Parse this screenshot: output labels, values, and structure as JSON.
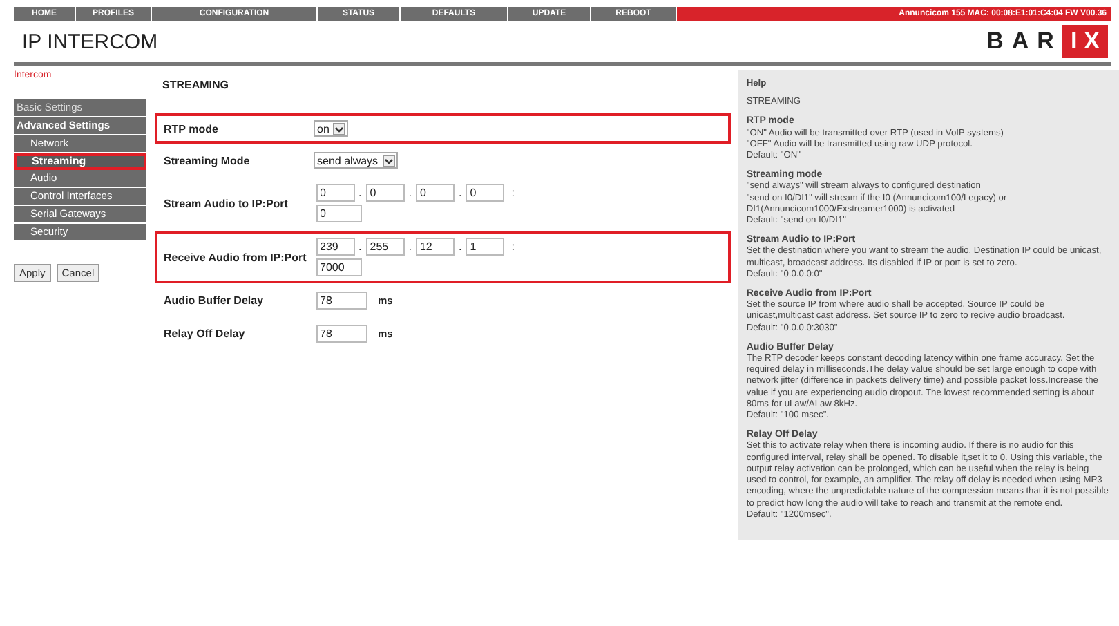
{
  "nav": {
    "items": [
      "HOME",
      "PROFILES",
      "CONFIGURATION",
      "STATUS",
      "DEFAULTS",
      "UPDATE",
      "REBOOT"
    ],
    "device_info": "Annuncicom 155   MAC: 00:08:E1:01:C4:04   FW V00.36"
  },
  "header": {
    "title": "IP INTERCOM",
    "logo_left": "BAR",
    "logo_right": "IX"
  },
  "breadcrumb": "Intercom",
  "sidebar": {
    "items": [
      {
        "label": "Basic Settings",
        "kind": "section",
        "selected": false
      },
      {
        "label": "Advanced Settings",
        "kind": "section-open",
        "selected": false
      },
      {
        "label": "Network",
        "kind": "sub",
        "selected": false
      },
      {
        "label": "Streaming",
        "kind": "sub",
        "selected": true
      },
      {
        "label": "Audio",
        "kind": "sub",
        "selected": false
      },
      {
        "label": "Control Interfaces",
        "kind": "sub",
        "selected": false
      },
      {
        "label": "Serial Gateways",
        "kind": "sub",
        "selected": false
      },
      {
        "label": "Security",
        "kind": "sub",
        "selected": false
      }
    ]
  },
  "buttons": [
    "Apply",
    "Cancel"
  ],
  "form": {
    "title": "STREAMING",
    "rows": [
      {
        "kind": "select",
        "label": "RTP mode",
        "value": "on",
        "highlighted": true
      },
      {
        "kind": "select",
        "label": "Streaming Mode",
        "value": "send always",
        "highlighted": false
      },
      {
        "kind": "ip",
        "label": "Stream Audio to IP:Port",
        "octets": [
          "0",
          "0",
          "0",
          "0"
        ],
        "octet_separator": ".",
        "port_separator": ":",
        "port": "0",
        "highlighted": false
      },
      {
        "kind": "ip",
        "label": "Receive Audio from IP:Port",
        "octets": [
          "239",
          "255",
          "12",
          "1"
        ],
        "octet_separator": ".",
        "port_separator": ":",
        "port": "7000",
        "highlighted": true
      },
      {
        "kind": "unit",
        "label": "Audio Buffer Delay",
        "value": "78",
        "unit": "ms",
        "highlighted": false
      },
      {
        "kind": "unit",
        "label": "Relay Off Delay",
        "value": "78",
        "unit": "ms",
        "highlighted": false
      }
    ]
  },
  "help": {
    "title": "Help",
    "subtitle": "STREAMING",
    "sections": [
      {
        "heading": "RTP mode",
        "lines": [
          "\"ON\" Audio will be transmitted over RTP (used in VoIP systems)",
          "\"OFF\" Audio will be transmitted using raw UDP protocol.",
          "Default: \"ON\""
        ]
      },
      {
        "heading": "Streaming mode",
        "lines": [
          "\"send always\" will stream always to configured destination",
          "\"send on I0/DI1\" will stream if the I0 (Annuncicom100/Legacy) or DI1(Annuncicom1000/Exstreamer1000) is activated",
          "Default: \"send on I0/DI1\""
        ]
      },
      {
        "heading": "Stream Audio to IP:Port",
        "lines": [
          "Set the destination where you want to stream the audio. Destination IP could be unicast, multicast, broadcast address. Its disabled if IP or port is set to zero.",
          "Default: \"0.0.0.0:0\""
        ]
      },
      {
        "heading": "Receive Audio from IP:Port",
        "lines": [
          "Set the source IP from where audio shall be accepted. Source IP could be unicast,multicast cast address. Set source IP to zero to recive audio broadcast.",
          "Default: \"0.0.0.0:3030\""
        ]
      },
      {
        "heading": "Audio Buffer Delay",
        "lines": [
          "The RTP decoder keeps constant decoding latency within one frame accuracy. Set the required delay in milliseconds.The delay value should be set large enough to cope with network jitter (difference in packets delivery time) and possible packet loss.Increase the value if you are experiencing audio dropout. The lowest recommended setting is about 80ms for uLaw/ALaw 8kHz.",
          "Default: \"100 msec\"."
        ]
      },
      {
        "heading": "Relay Off Delay",
        "lines": [
          "Set this to activate relay when there is incoming audio. If there is no audio for this configured interval, relay shall be opened. To disable it,set it to 0. Using this variable, the output relay activation can be prolonged, which can be useful when the relay is being used to control, for example, an amplifier. The relay off delay is needed when using MP3 encoding, where the unpredictable nature of the compression means that it is not possible to predict how long the audio will take to reach and transmit at the remote end.",
          "Default: \"1200msec\"."
        ]
      }
    ]
  }
}
